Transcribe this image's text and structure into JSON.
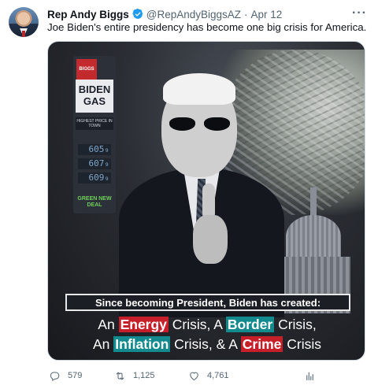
{
  "tweet": {
    "author_name": "Rep Andy Biggs",
    "handle": "@RepAndyBiggsAZ",
    "separator": "·",
    "date": "Apr 12",
    "more_label": "···",
    "text": "Joe Biden's entire presidency has become one big crisis for America."
  },
  "image": {
    "logo_text": "BIGGS",
    "sign_brand_line1": "BIDEN",
    "sign_brand_line2": "GAS",
    "sign_price_label": "HIGHEST PRICE IN TOWN",
    "sign_prices": [
      "605₉",
      "607₉",
      "609₉"
    ],
    "sign_footer": "GREEN NEW DEAL",
    "banner": "Since becoming President, Biden has created:",
    "line1": {
      "a": "An ",
      "b": "Energy",
      "c": " Crisis, A ",
      "d": "Border",
      "e": " Crisis,"
    },
    "line2": {
      "a": "An ",
      "b": "Inflation",
      "c": " Crisis, & A ",
      "d": "Crime",
      "e": " Crisis"
    }
  },
  "actions": {
    "replies": "579",
    "retweets": "1,125",
    "likes": "4,761"
  },
  "colors": {
    "verified": "#1d9bf0",
    "muted": "#536471",
    "highlight_red": "#c61f2a",
    "highlight_teal": "#138a8e"
  },
  "icons": [
    "verified-badge-icon",
    "more-icon",
    "reply-icon",
    "retweet-icon",
    "like-icon",
    "analytics-icon"
  ]
}
